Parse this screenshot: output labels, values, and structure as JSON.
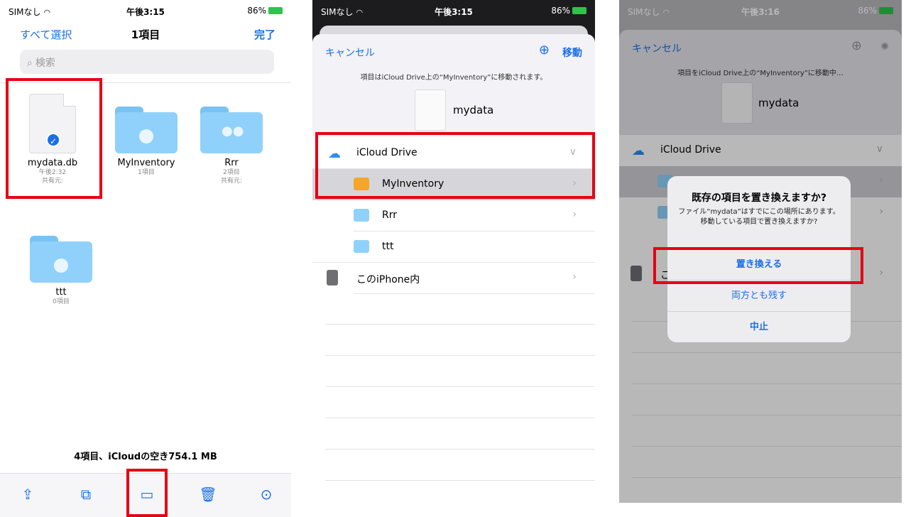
{
  "status": {
    "carrier": "SIMなし",
    "time1": "午後3:15",
    "time2": "午後3:15",
    "time3": "午後3:16",
    "battery": "86%"
  },
  "screen1": {
    "nav": {
      "select_all": "すべて選択",
      "title": "1項目",
      "done": "完了"
    },
    "search_placeholder": "検索",
    "items": [
      {
        "name": "mydata.db",
        "meta1": "午後2:32",
        "meta2": "共有元:"
      },
      {
        "name": "MyInventory",
        "meta1": "1項目",
        "meta2": ""
      },
      {
        "name": "Rrr",
        "meta1": "2項目",
        "meta2": "共有元:"
      },
      {
        "name": "ttt",
        "meta1": "0項目",
        "meta2": ""
      }
    ],
    "footer_text": "4項目、iCloudの空き754.1 MB",
    "toolbar": [
      "share-icon",
      "duplicate-icon",
      "folder-icon",
      "trash-icon",
      "more-icon"
    ]
  },
  "screen2": {
    "cancel": "キャンセル",
    "move": "移動",
    "description": "項目はiCloud Drive上の“MyInventory”に移動されます。",
    "file_name": "mydata",
    "rows": [
      {
        "label": "iCloud Drive",
        "chevron": "∨"
      },
      {
        "label": "MyInventory",
        "chevron": "›"
      },
      {
        "label": "Rrr",
        "chevron": "›"
      },
      {
        "label": "ttt",
        "chevron": ""
      },
      {
        "label": "このiPhone内",
        "chevron": "›"
      }
    ]
  },
  "screen3": {
    "cancel": "キャンセル",
    "description": "項目をiCloud Drive上の“MyInventory”に移動中…",
    "file_name": "mydata",
    "rows": [
      {
        "label": "iCloud Drive",
        "chevron": "∨"
      },
      {
        "label": "こ",
        "chevron": "›"
      }
    ],
    "alert": {
      "title": "既存の項目を置き換えますか?",
      "message": "ファイル“mydata”はすでにこの場所にあります。移動している項目で置き換えますか?",
      "replace": "置き換える",
      "keep_both": "両方とも残す",
      "stop": "中止"
    }
  },
  "colors": {
    "accent": "#1a6fe8",
    "highlight": "#e60012",
    "folder": "#8fd1fa"
  }
}
